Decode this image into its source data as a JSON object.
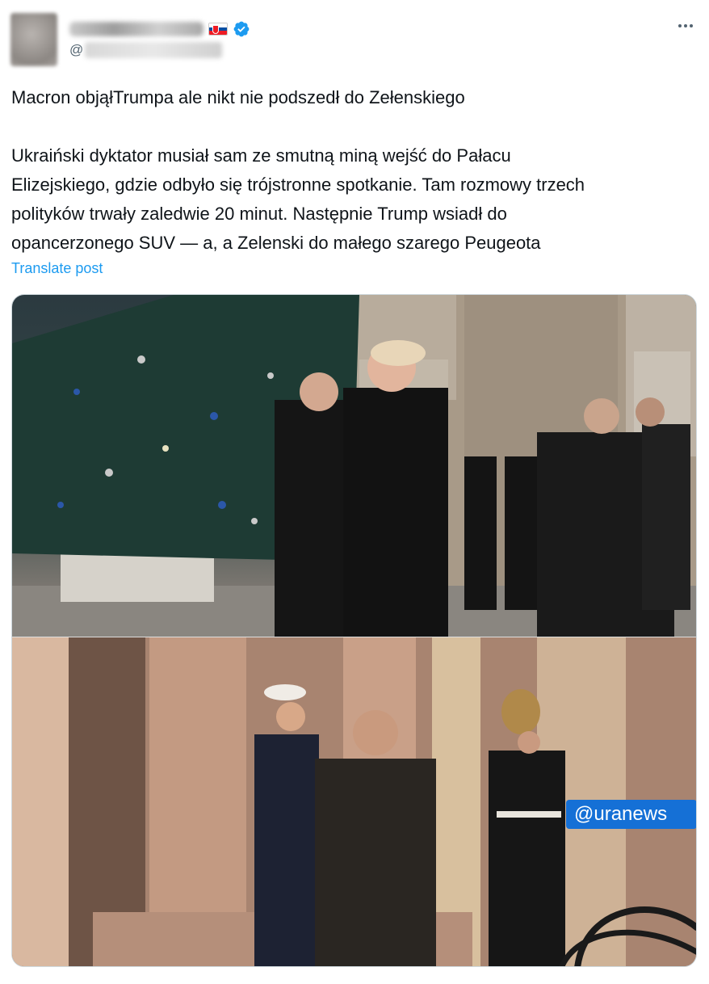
{
  "post": {
    "author": {
      "display_name_redacted": true,
      "handle_prefix": "@",
      "verified": true,
      "flag": "slovakia-flag"
    },
    "more_icon": "ellipsis-icon",
    "headline": "Macron objąłTrumpa ale nikt nie podszedł do Zełenskiego",
    "body_lines": [
      "Ukraiński dyktator musiał sam ze smutną miną wejść do Pałacu",
      "Elizejskiego, gdzie odbyło się trójstronne spotkanie. Tam rozmowy trzech",
      "polityków trwały zaledwie 20 minut. Następnie Trump wsiadł do",
      "opancerzonego SUV — a, a Zelenski do małego szarego Peugeota"
    ],
    "translate_label": "Translate post",
    "media": {
      "watermark": "@uranews"
    }
  },
  "colors": {
    "link": "#1d9bf0",
    "text": "#0f1419",
    "secondary": "#536471",
    "verified": "#1d9bf0",
    "watermark_bg": "#1570d6"
  }
}
